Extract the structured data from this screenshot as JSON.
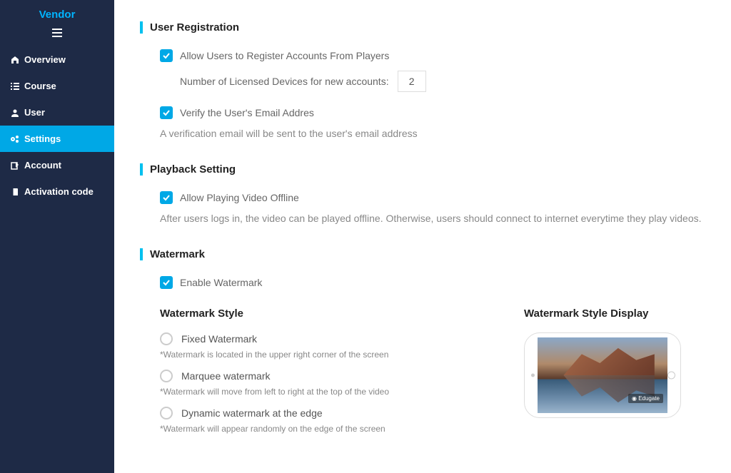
{
  "brand": "Vendor",
  "sidebar": {
    "items": [
      {
        "icon": "home-icon",
        "label": "Overview"
      },
      {
        "icon": "list-icon",
        "label": "Course"
      },
      {
        "icon": "user-icon",
        "label": "User"
      },
      {
        "icon": "gears-icon",
        "label": "Settings"
      },
      {
        "icon": "edit-icon",
        "label": "Account"
      },
      {
        "icon": "book-icon",
        "label": "Activation code"
      }
    ]
  },
  "sections": {
    "user_reg": {
      "title": "User Registration",
      "allow_register_label": "Allow Users to Register Accounts From Players",
      "num_devices_label": "Number of Licensed Devices for new accounts:",
      "num_devices_value": "2",
      "verify_email_label": "Verify the User's Email Addres",
      "verify_help": "A verification email will be sent to the user's email address"
    },
    "playback": {
      "title": "Playback Setting",
      "allow_offline_label": "Allow Playing Video Offline",
      "offline_help": "After users logs in, the video can be played offline. Otherwise, users should connect to internet everytime they play videos."
    },
    "watermark": {
      "title": "Watermark",
      "enable_label": "Enable Watermark",
      "style_heading": "Watermark Style",
      "display_heading": "Watermark Style Display",
      "options": [
        {
          "label": "Fixed Watermark",
          "hint": "*Watermark is located in the upper right corner of the screen"
        },
        {
          "label": "Marquee watermark",
          "hint": "*Watermark will move from left to right at the top of the video"
        },
        {
          "label": "Dynamic watermark at the edge",
          "hint": "*Watermark will appear randomly on the edge of the screen"
        }
      ],
      "preview_badge": "Edugate"
    }
  }
}
